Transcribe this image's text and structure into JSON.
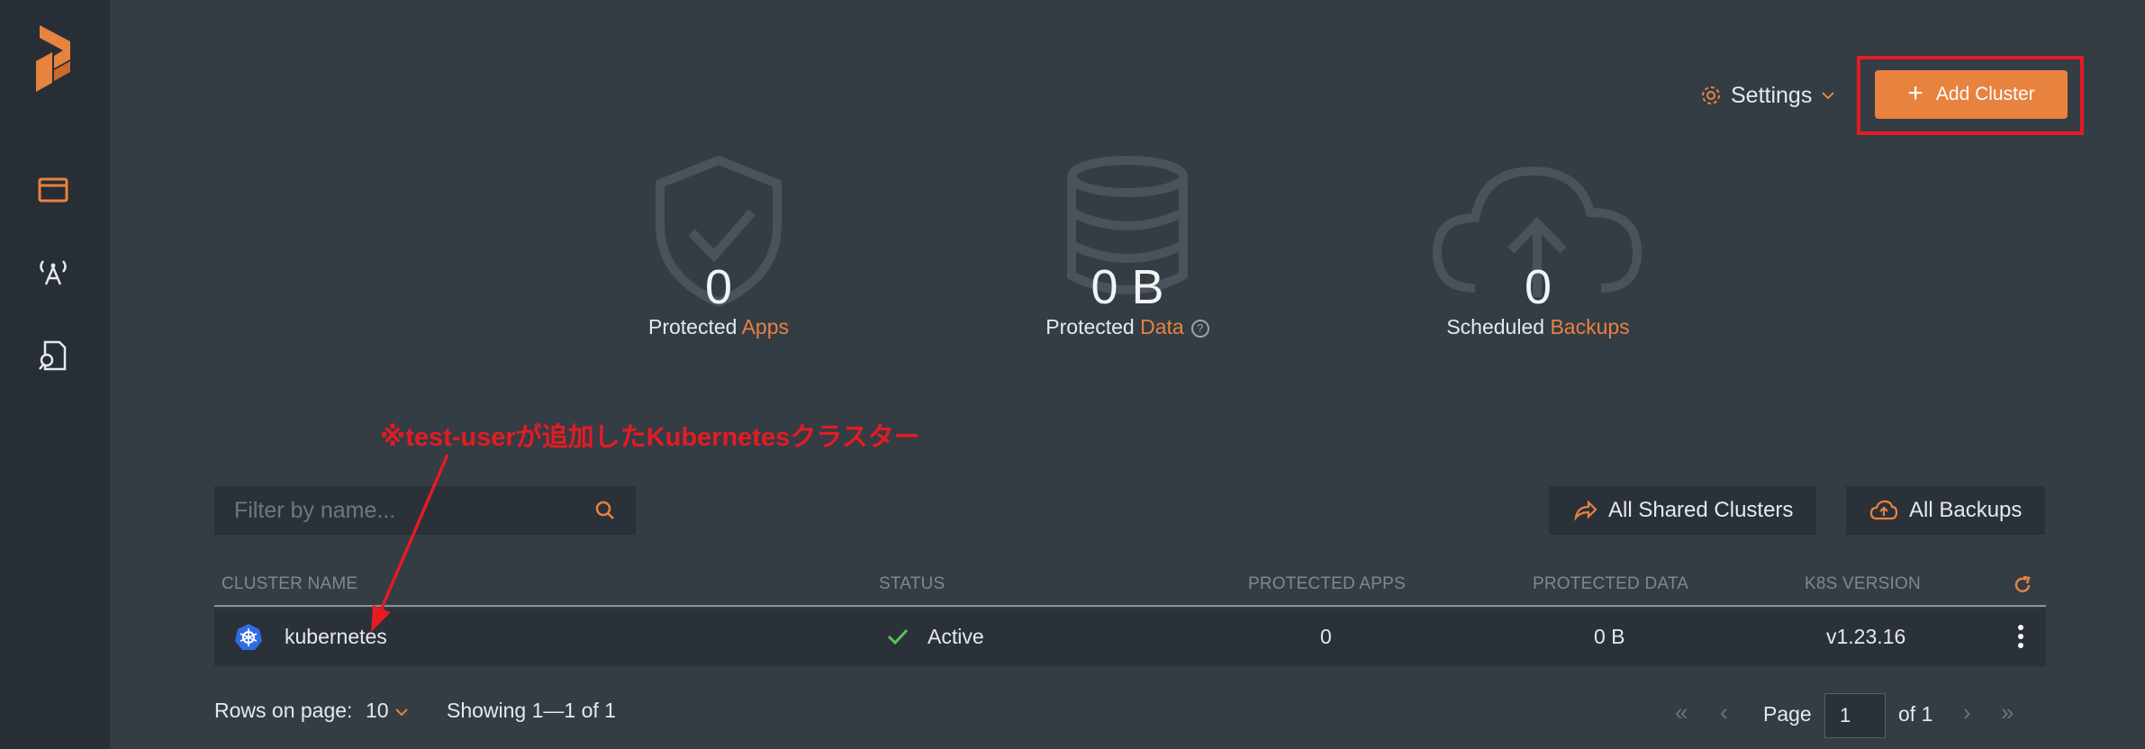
{
  "header": {
    "settings_label": "Settings",
    "add_cluster_label": "Add Cluster"
  },
  "stats": [
    {
      "value": "0",
      "label_plain": "Protected ",
      "label_accent": "Apps"
    },
    {
      "value": "0 B",
      "label_plain": "Protected ",
      "label_accent": "Data"
    },
    {
      "value": "0",
      "label_plain": "Scheduled ",
      "label_accent": "Backups"
    }
  ],
  "annotation": "※test-userが追加したKubernetesクラスター",
  "filter": {
    "placeholder": "Filter by name..."
  },
  "actions": {
    "shared_clusters": "All Shared Clusters",
    "all_backups": "All Backups"
  },
  "table": {
    "headers": [
      "CLUSTER NAME",
      "STATUS",
      "PROTECTED APPS",
      "PROTECTED DATA",
      "K8S VERSION"
    ],
    "rows": [
      {
        "name": "kubernetes",
        "status": "Active",
        "protected_apps": "0",
        "protected_data": "0 B",
        "version": "v1.23.16"
      }
    ]
  },
  "footer": {
    "rows_label": "Rows on page:",
    "rows_value": "10",
    "showing": "Showing 1—1 of 1",
    "page_label": "Page",
    "page_value": "1",
    "of_label": "of 1"
  },
  "colors": {
    "accent": "#e8823f",
    "annotation_red": "#e41b23",
    "status_ok": "#5fbf5f"
  },
  "icons": {
    "sidebar": [
      "portworx-logo",
      "browser-window-icon",
      "broadcast-icon",
      "file-search-icon"
    ]
  }
}
